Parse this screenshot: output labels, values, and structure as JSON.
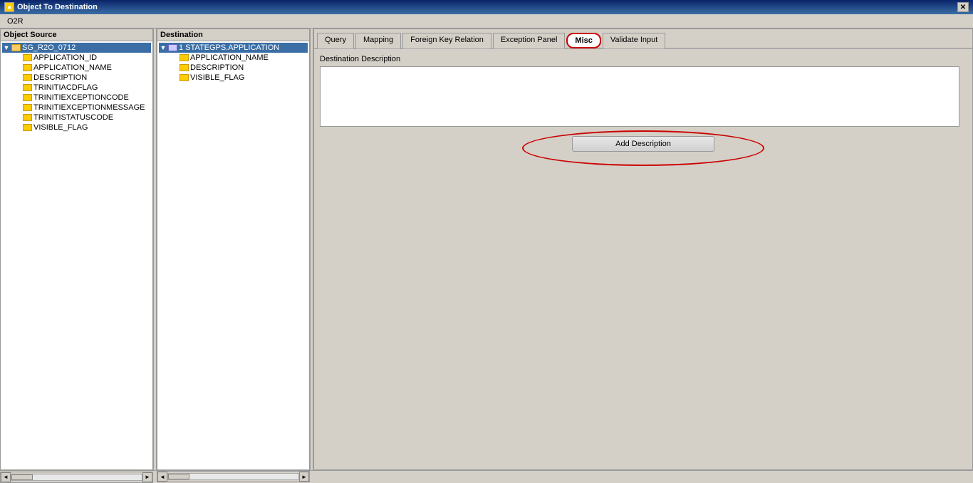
{
  "window": {
    "title": "Object To Destination",
    "close_label": "✕"
  },
  "menu": {
    "items": [
      "O2R"
    ]
  },
  "left_panel": {
    "header": "Object Source",
    "tree": {
      "root": {
        "label": "SG_R2O_0712",
        "selected": true,
        "children": [
          {
            "label": "APPLICATION_ID"
          },
          {
            "label": "APPLICATION_NAME"
          },
          {
            "label": "DESCRIPTION"
          },
          {
            "label": "TRINITIACDFLAG"
          },
          {
            "label": "TRINITIEXCEPTIONCODE"
          },
          {
            "label": "TRINITIEXCEPTIONMESSAGE"
          },
          {
            "label": "TRINITISTATUSCODE"
          },
          {
            "label": "VISIBLE_FLAG"
          }
        ]
      }
    }
  },
  "middle_panel": {
    "header": "Destination",
    "tree": {
      "root": {
        "label": "1 STATEGPS.APPLICATION",
        "selected": true,
        "children": [
          {
            "label": "APPLICATION_NAME"
          },
          {
            "label": "DESCRIPTION"
          },
          {
            "label": "VISIBLE_FLAG"
          }
        ]
      }
    }
  },
  "tabs": [
    {
      "id": "query",
      "label": "Query",
      "active": false
    },
    {
      "id": "mapping",
      "label": "Mapping",
      "active": false
    },
    {
      "id": "foreign-key",
      "label": "Foreign Key Relation",
      "active": false
    },
    {
      "id": "exception",
      "label": "Exception Panel",
      "active": false
    },
    {
      "id": "misc",
      "label": "Misc",
      "active": true,
      "highlighted": true
    },
    {
      "id": "validate",
      "label": "Validate Input",
      "active": false
    }
  ],
  "misc_tab": {
    "section_label": "Destination Description",
    "description_value": "",
    "description_placeholder": "",
    "add_description_button": "Add Description"
  }
}
